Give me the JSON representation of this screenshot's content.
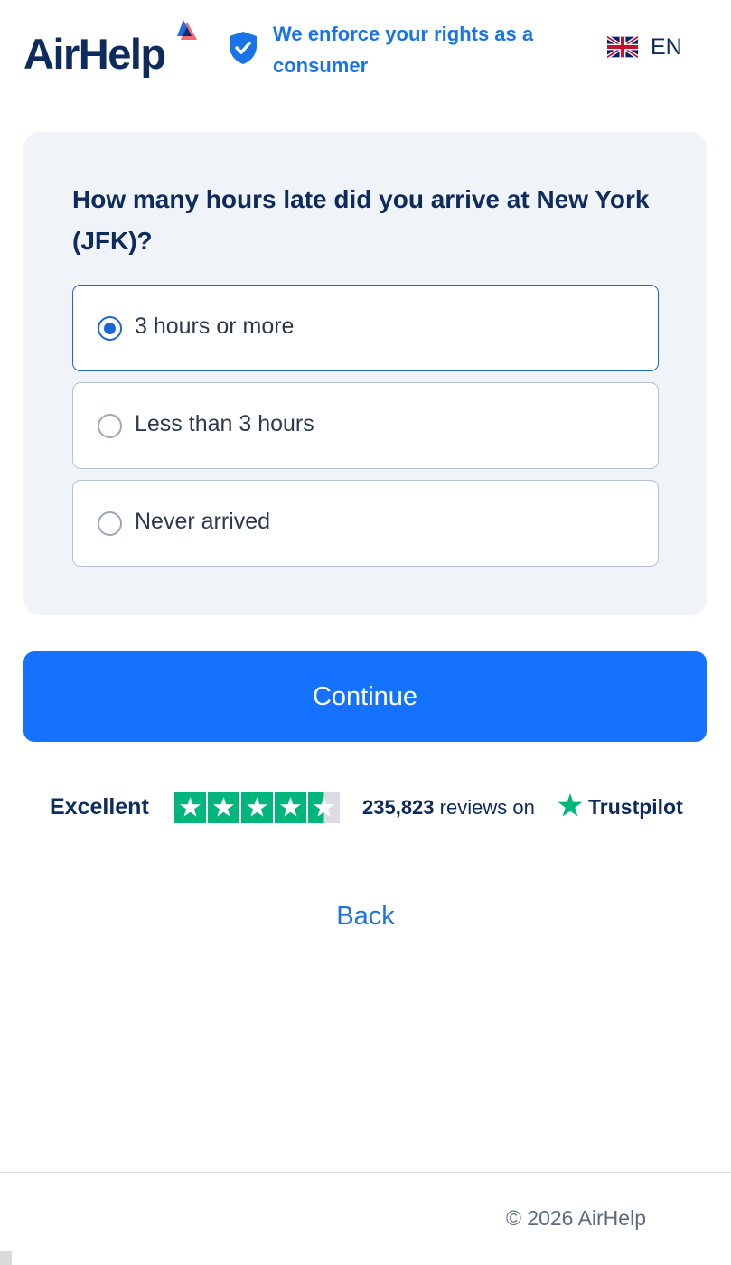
{
  "header": {
    "logo_text": "AirHelp",
    "badge_text": "We enforce your rights as a consumer",
    "language": "EN"
  },
  "question": {
    "text": "How many hours late did you arrive at New York (JFK)?",
    "options": [
      {
        "label": "3 hours or more",
        "selected": true
      },
      {
        "label": "Less than 3 hours",
        "selected": false
      },
      {
        "label": "Never arrived",
        "selected": false
      }
    ]
  },
  "continue_label": "Continue",
  "trustpilot": {
    "rating_label": "Excellent",
    "rating_stars": 4.5,
    "review_count": "235,823",
    "reviews_text": " reviews on",
    "brand": "Trustpilot"
  },
  "back_label": "Back",
  "footer": {
    "copyright": "© 2026 AirHelp"
  },
  "colors": {
    "brand_navy": "#0d2b5c",
    "accent_blue": "#1472ff",
    "link_blue": "#1a73e8",
    "trustpilot_green": "#00b67a"
  }
}
